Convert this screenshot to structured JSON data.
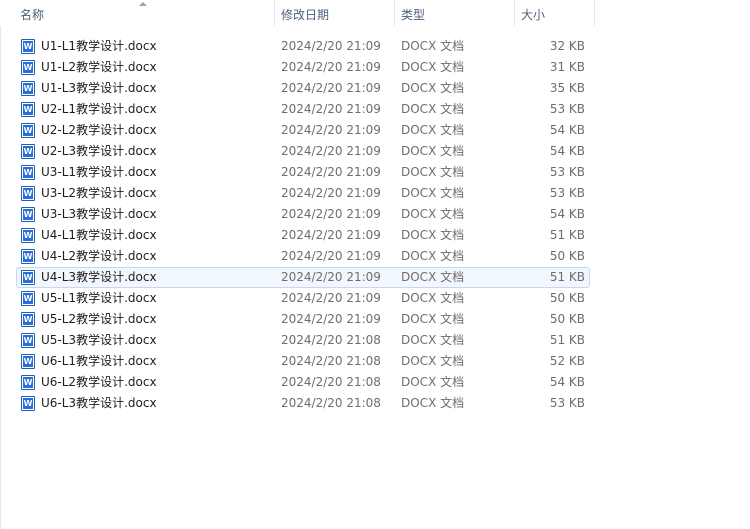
{
  "columns": {
    "name": "名称",
    "date": "修改日期",
    "type": "类型",
    "size": "大小"
  },
  "files": [
    {
      "name": "U1-L1教学设计.docx",
      "date": "2024/2/20 21:09",
      "type": "DOCX 文档",
      "size": "32 KB"
    },
    {
      "name": "U1-L2教学设计.docx",
      "date": "2024/2/20 21:09",
      "type": "DOCX 文档",
      "size": "31 KB"
    },
    {
      "name": "U1-L3教学设计.docx",
      "date": "2024/2/20 21:09",
      "type": "DOCX 文档",
      "size": "35 KB"
    },
    {
      "name": "U2-L1教学设计.docx",
      "date": "2024/2/20 21:09",
      "type": "DOCX 文档",
      "size": "53 KB"
    },
    {
      "name": "U2-L2教学设计.docx",
      "date": "2024/2/20 21:09",
      "type": "DOCX 文档",
      "size": "54 KB"
    },
    {
      "name": "U2-L3教学设计.docx",
      "date": "2024/2/20 21:09",
      "type": "DOCX 文档",
      "size": "54 KB"
    },
    {
      "name": "U3-L1教学设计.docx",
      "date": "2024/2/20 21:09",
      "type": "DOCX 文档",
      "size": "53 KB"
    },
    {
      "name": "U3-L2教学设计.docx",
      "date": "2024/2/20 21:09",
      "type": "DOCX 文档",
      "size": "53 KB"
    },
    {
      "name": "U3-L3教学设计.docx",
      "date": "2024/2/20 21:09",
      "type": "DOCX 文档",
      "size": "54 KB"
    },
    {
      "name": "U4-L1教学设计.docx",
      "date": "2024/2/20 21:09",
      "type": "DOCX 文档",
      "size": "51 KB"
    },
    {
      "name": "U4-L2教学设计.docx",
      "date": "2024/2/20 21:09",
      "type": "DOCX 文档",
      "size": "50 KB"
    },
    {
      "name": "U4-L3教学设计.docx",
      "date": "2024/2/20 21:09",
      "type": "DOCX 文档",
      "size": "51 KB",
      "hover": true
    },
    {
      "name": "U5-L1教学设计.docx",
      "date": "2024/2/20 21:09",
      "type": "DOCX 文档",
      "size": "50 KB"
    },
    {
      "name": "U5-L2教学设计.docx",
      "date": "2024/2/20 21:09",
      "type": "DOCX 文档",
      "size": "50 KB"
    },
    {
      "name": "U5-L3教学设计.docx",
      "date": "2024/2/20 21:08",
      "type": "DOCX 文档",
      "size": "51 KB"
    },
    {
      "name": "U6-L1教学设计.docx",
      "date": "2024/2/20 21:08",
      "type": "DOCX 文档",
      "size": "52 KB"
    },
    {
      "name": "U6-L2教学设计.docx",
      "date": "2024/2/20 21:08",
      "type": "DOCX 文档",
      "size": "54 KB"
    },
    {
      "name": "U6-L3教学设计.docx",
      "date": "2024/2/20 21:08",
      "type": "DOCX 文档",
      "size": "53 KB"
    }
  ],
  "icon": {
    "name": "word-doc-icon",
    "glyph": "W",
    "color": "#2a6fd6"
  }
}
